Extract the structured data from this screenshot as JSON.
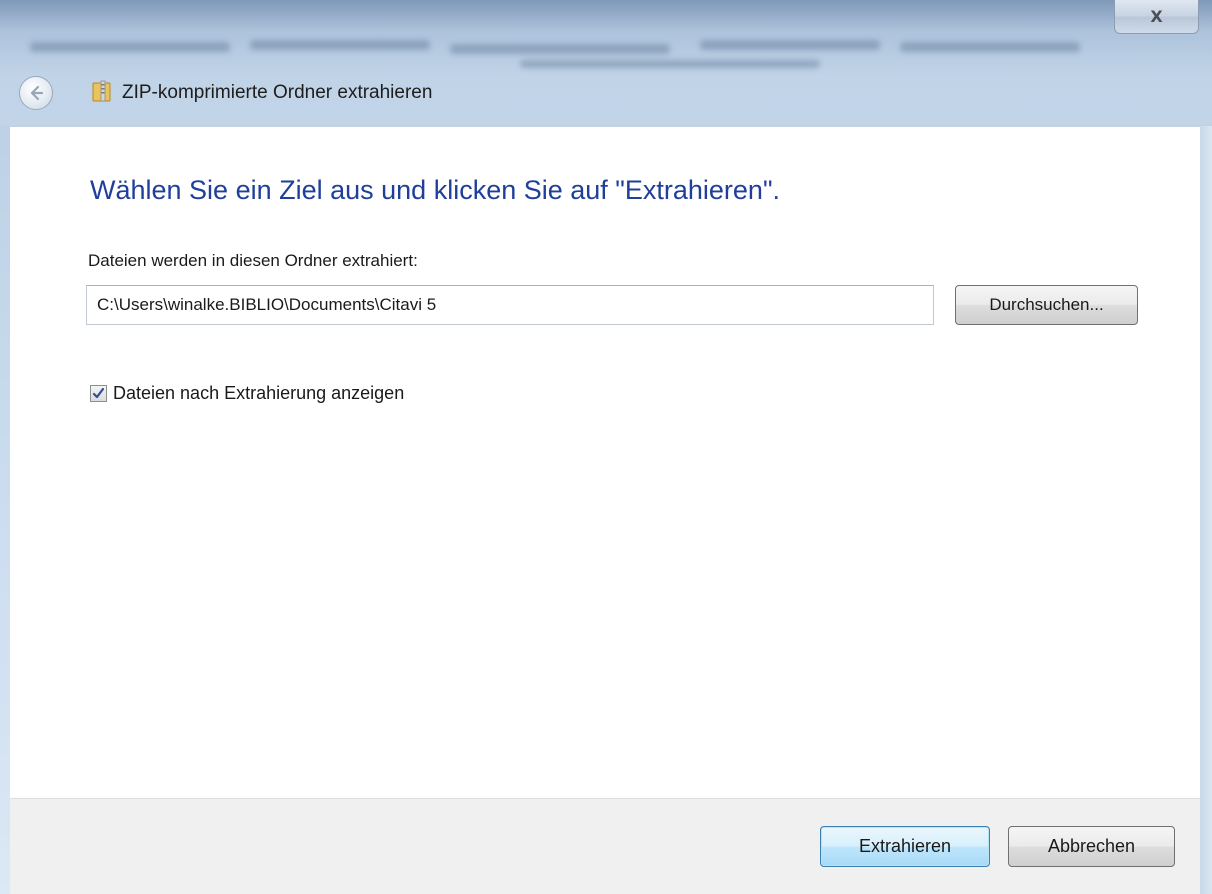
{
  "window": {
    "close_label": "X",
    "title": "ZIP-komprimierte Ordner extrahieren"
  },
  "main": {
    "heading": "Wählen Sie ein Ziel aus und klicken Sie auf \"Extrahieren\".",
    "folder_label": "Dateien werden in diesen Ordner extrahiert:",
    "folder_path": "C:\\Users\\winalke.BIBLIO\\Documents\\Citavi 5",
    "browse_label": "Durchsuchen...",
    "show_files_label": "Dateien nach Extrahierung anzeigen",
    "show_files_checked": true
  },
  "footer": {
    "extract_label": "Extrahieren",
    "cancel_label": "Abbrechen"
  },
  "colors": {
    "heading": "#1f3f9a",
    "default_button_border": "#3c7fb1",
    "footer_bg": "#f0f0f0"
  },
  "icons": {
    "back": "back-arrow-icon",
    "title": "zip-folder-icon",
    "close": "close-icon",
    "checkbox": "checkmark-icon"
  }
}
